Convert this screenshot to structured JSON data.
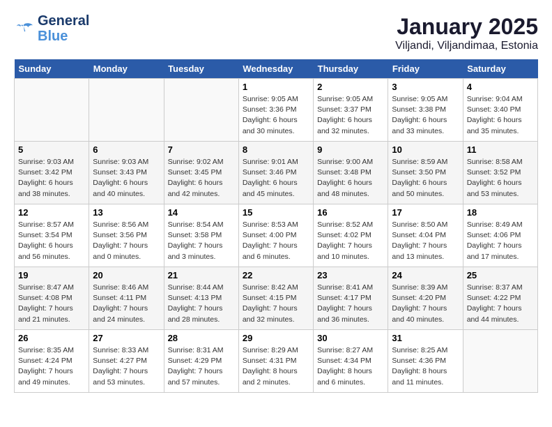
{
  "logo": {
    "text_general": "General",
    "text_blue": "Blue"
  },
  "title": "January 2025",
  "subtitle": "Viljandi, Viljandimaa, Estonia",
  "weekdays": [
    "Sunday",
    "Monday",
    "Tuesday",
    "Wednesday",
    "Thursday",
    "Friday",
    "Saturday"
  ],
  "weeks": [
    [
      {
        "day": "",
        "info": ""
      },
      {
        "day": "",
        "info": ""
      },
      {
        "day": "",
        "info": ""
      },
      {
        "day": "1",
        "info": "Sunrise: 9:05 AM\nSunset: 3:36 PM\nDaylight: 6 hours\nand 30 minutes."
      },
      {
        "day": "2",
        "info": "Sunrise: 9:05 AM\nSunset: 3:37 PM\nDaylight: 6 hours\nand 32 minutes."
      },
      {
        "day": "3",
        "info": "Sunrise: 9:05 AM\nSunset: 3:38 PM\nDaylight: 6 hours\nand 33 minutes."
      },
      {
        "day": "4",
        "info": "Sunrise: 9:04 AM\nSunset: 3:40 PM\nDaylight: 6 hours\nand 35 minutes."
      }
    ],
    [
      {
        "day": "5",
        "info": "Sunrise: 9:03 AM\nSunset: 3:42 PM\nDaylight: 6 hours\nand 38 minutes."
      },
      {
        "day": "6",
        "info": "Sunrise: 9:03 AM\nSunset: 3:43 PM\nDaylight: 6 hours\nand 40 minutes."
      },
      {
        "day": "7",
        "info": "Sunrise: 9:02 AM\nSunset: 3:45 PM\nDaylight: 6 hours\nand 42 minutes."
      },
      {
        "day": "8",
        "info": "Sunrise: 9:01 AM\nSunset: 3:46 PM\nDaylight: 6 hours\nand 45 minutes."
      },
      {
        "day": "9",
        "info": "Sunrise: 9:00 AM\nSunset: 3:48 PM\nDaylight: 6 hours\nand 48 minutes."
      },
      {
        "day": "10",
        "info": "Sunrise: 8:59 AM\nSunset: 3:50 PM\nDaylight: 6 hours\nand 50 minutes."
      },
      {
        "day": "11",
        "info": "Sunrise: 8:58 AM\nSunset: 3:52 PM\nDaylight: 6 hours\nand 53 minutes."
      }
    ],
    [
      {
        "day": "12",
        "info": "Sunrise: 8:57 AM\nSunset: 3:54 PM\nDaylight: 6 hours\nand 56 minutes."
      },
      {
        "day": "13",
        "info": "Sunrise: 8:56 AM\nSunset: 3:56 PM\nDaylight: 7 hours\nand 0 minutes."
      },
      {
        "day": "14",
        "info": "Sunrise: 8:54 AM\nSunset: 3:58 PM\nDaylight: 7 hours\nand 3 minutes."
      },
      {
        "day": "15",
        "info": "Sunrise: 8:53 AM\nSunset: 4:00 PM\nDaylight: 7 hours\nand 6 minutes."
      },
      {
        "day": "16",
        "info": "Sunrise: 8:52 AM\nSunset: 4:02 PM\nDaylight: 7 hours\nand 10 minutes."
      },
      {
        "day": "17",
        "info": "Sunrise: 8:50 AM\nSunset: 4:04 PM\nDaylight: 7 hours\nand 13 minutes."
      },
      {
        "day": "18",
        "info": "Sunrise: 8:49 AM\nSunset: 4:06 PM\nDaylight: 7 hours\nand 17 minutes."
      }
    ],
    [
      {
        "day": "19",
        "info": "Sunrise: 8:47 AM\nSunset: 4:08 PM\nDaylight: 7 hours\nand 21 minutes."
      },
      {
        "day": "20",
        "info": "Sunrise: 8:46 AM\nSunset: 4:11 PM\nDaylight: 7 hours\nand 24 minutes."
      },
      {
        "day": "21",
        "info": "Sunrise: 8:44 AM\nSunset: 4:13 PM\nDaylight: 7 hours\nand 28 minutes."
      },
      {
        "day": "22",
        "info": "Sunrise: 8:42 AM\nSunset: 4:15 PM\nDaylight: 7 hours\nand 32 minutes."
      },
      {
        "day": "23",
        "info": "Sunrise: 8:41 AM\nSunset: 4:17 PM\nDaylight: 7 hours\nand 36 minutes."
      },
      {
        "day": "24",
        "info": "Sunrise: 8:39 AM\nSunset: 4:20 PM\nDaylight: 7 hours\nand 40 minutes."
      },
      {
        "day": "25",
        "info": "Sunrise: 8:37 AM\nSunset: 4:22 PM\nDaylight: 7 hours\nand 44 minutes."
      }
    ],
    [
      {
        "day": "26",
        "info": "Sunrise: 8:35 AM\nSunset: 4:24 PM\nDaylight: 7 hours\nand 49 minutes."
      },
      {
        "day": "27",
        "info": "Sunrise: 8:33 AM\nSunset: 4:27 PM\nDaylight: 7 hours\nand 53 minutes."
      },
      {
        "day": "28",
        "info": "Sunrise: 8:31 AM\nSunset: 4:29 PM\nDaylight: 7 hours\nand 57 minutes."
      },
      {
        "day": "29",
        "info": "Sunrise: 8:29 AM\nSunset: 4:31 PM\nDaylight: 8 hours\nand 2 minutes."
      },
      {
        "day": "30",
        "info": "Sunrise: 8:27 AM\nSunset: 4:34 PM\nDaylight: 8 hours\nand 6 minutes."
      },
      {
        "day": "31",
        "info": "Sunrise: 8:25 AM\nSunset: 4:36 PM\nDaylight: 8 hours\nand 11 minutes."
      },
      {
        "day": "",
        "info": ""
      }
    ]
  ]
}
